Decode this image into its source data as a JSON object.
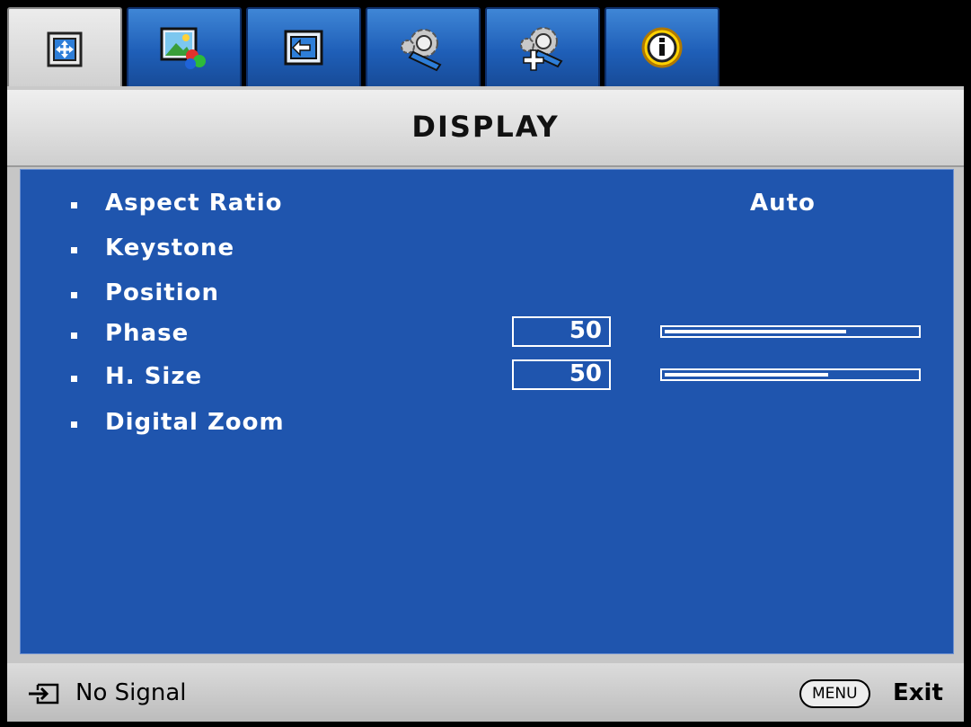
{
  "tabs": [
    {
      "icon": "display-icon",
      "active": true
    },
    {
      "icon": "picture-icon",
      "active": false
    },
    {
      "icon": "source-icon",
      "active": false
    },
    {
      "icon": "setup-basic-icon",
      "active": false
    },
    {
      "icon": "setup-advanced-icon",
      "active": false
    },
    {
      "icon": "information-icon",
      "active": false
    }
  ],
  "header": {
    "title": "DISPLAY"
  },
  "menu": {
    "items": [
      {
        "label": "Aspect Ratio",
        "value": "Auto"
      },
      {
        "label": "Keystone"
      },
      {
        "label": "Position"
      },
      {
        "label": "Phase",
        "value": "50",
        "slider_fraction": 0.72
      },
      {
        "label": "H. Size",
        "value": "50",
        "slider_fraction": 0.65
      },
      {
        "label": "Digital Zoom"
      }
    ]
  },
  "footer": {
    "signal_icon": "input-source-icon",
    "signal_text": "No Signal",
    "menu_key": "MENU",
    "exit_text": "Exit"
  },
  "colors": {
    "panel_blue": "#1f55ae",
    "tab_blue": "#1f5fb8",
    "text": "#ffffff"
  }
}
